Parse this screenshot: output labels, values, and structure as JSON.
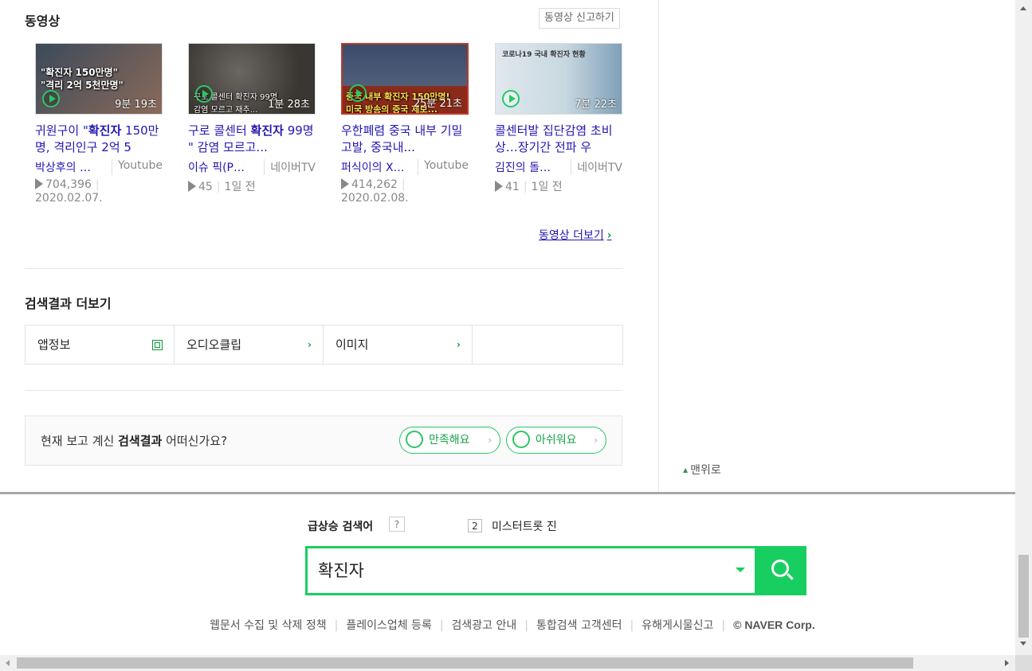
{
  "video_section": {
    "title": "동영상",
    "report_label": "동영상 신고하기",
    "more_label": "동영상 더보기",
    "videos": [
      {
        "thumb_caption": "\"확진자 150만명\"\n\"격리 2억 5천만명\"",
        "thumb_colors": [
          "#3c4a5a",
          "#8a6a5a"
        ],
        "duration": "9분 19초",
        "title_pre": "귀원구이 \"",
        "title_bold": "확진자",
        "title_post": " 150만명, 격리인구 2억 5",
        "channel": "박상후의 …",
        "source": "Youtube",
        "views": "704,396",
        "date": "2020.02.07."
      },
      {
        "thumb_caption": "구로 콜센터 확진자 99명\n감염 모르고 재추...",
        "thumb_colors": [
          "#5a5650",
          "#3a3632"
        ],
        "duration": "1분 28초",
        "title_pre": "구로 콜센터 ",
        "title_bold": "확진자",
        "title_post": " 99명 \" 감염 모르고...",
        "channel": "이슈 픽(P…",
        "source": "네이버TV",
        "views": "45",
        "date": "1일 전"
      },
      {
        "thumb_caption": "중국 내부 확진자 150만명!\n미국 방송의 중국 제보...",
        "thumb_colors": [
          "#3a4a6a",
          "#8a2a1a"
        ],
        "duration": "25분 21초",
        "title_pre": "우한폐렴 중국 내부 기밀 고발, 중국내...",
        "title_bold": "",
        "title_post": "",
        "channel": "퍼식이의 X…",
        "source": "Youtube",
        "views": "414,262",
        "date": "2020.02.08."
      },
      {
        "thumb_caption": "코로나19 국내 확진자 현황",
        "thumb_colors": [
          "#c8d8e0",
          "#7fa0b8"
        ],
        "duration": "7분 22초",
        "title_pre": "콜센터발 집단감염 초비상…장기간 전파 우",
        "title_bold": "",
        "title_post": "",
        "channel": "김진의 돌…",
        "source": "네이버TV",
        "views": "41",
        "date": "1일 전"
      }
    ]
  },
  "more_results": {
    "title": "검색결과 더보기",
    "items": [
      {
        "label": "앱정보",
        "icon": "external-link-icon"
      },
      {
        "label": "오디오클립",
        "icon": "chevron-right-icon"
      },
      {
        "label": "이미지",
        "icon": "chevron-right-icon"
      },
      {
        "label": "",
        "icon": ""
      }
    ]
  },
  "survey": {
    "question_pre": "현재 보고 계신 ",
    "question_bold": "검색결과",
    "question_post": " 어떠신가요?",
    "positive_label": "만족해요",
    "negative_label": "아쉬워요"
  },
  "right_col": {
    "to_top_label": "맨위로"
  },
  "footer": {
    "rising_label": "급상승 검색어",
    "help_label": "?",
    "rank_number": "2",
    "rank_keyword": "미스터트롯 진",
    "search_value": "확진자",
    "links": [
      "웹문서 수집 및 삭제 정책",
      "플레이스업체 등록",
      "검색광고 안내",
      "통합검색 고객센터",
      "유해게시물신고"
    ],
    "copyright": "© NAVER Corp."
  },
  "colors": {
    "naver_green": "#19ce60",
    "link_blue": "#2216b3"
  }
}
